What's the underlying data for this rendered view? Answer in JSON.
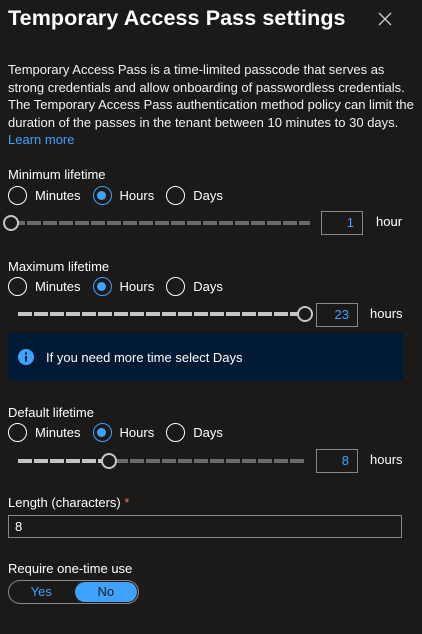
{
  "panel": {
    "title": "Temporary Access Pass settings",
    "description": "Temporary Access Pass is a time-limited passcode that serves as strong credentials and allow onboarding of passwordless credentials. The Temporary Access Pass authentication method policy can limit the duration of the passes in the tenant between 10 minutes to 30 days.",
    "learn_more": "Learn more",
    "close_icon": "close-icon"
  },
  "radio_options": [
    "Minutes",
    "Hours",
    "Days"
  ],
  "minimum_lifetime": {
    "label": "Minimum lifetime",
    "selected": "Hours",
    "value": "1",
    "unit": "hour",
    "slider_fraction": 0.0
  },
  "maximum_lifetime": {
    "label": "Maximum lifetime",
    "selected": "Hours",
    "value": "23",
    "unit": "hours",
    "slider_fraction": 1.0
  },
  "info_banner": {
    "icon": "info-icon",
    "message": "If you need more time select Days"
  },
  "default_lifetime": {
    "label": "Default lifetime",
    "selected": "Hours",
    "value": "8",
    "unit": "hours",
    "slider_fraction": 0.318
  },
  "length": {
    "label": "Length (characters)",
    "required_mark": "*",
    "value": "8"
  },
  "one_time_use": {
    "label": "Require one-time use",
    "yes": "Yes",
    "no": "No",
    "selected": "No"
  },
  "colors": {
    "background": "#1b1a19",
    "accent": "#3ea2ff",
    "info_banner": "#001a35"
  }
}
